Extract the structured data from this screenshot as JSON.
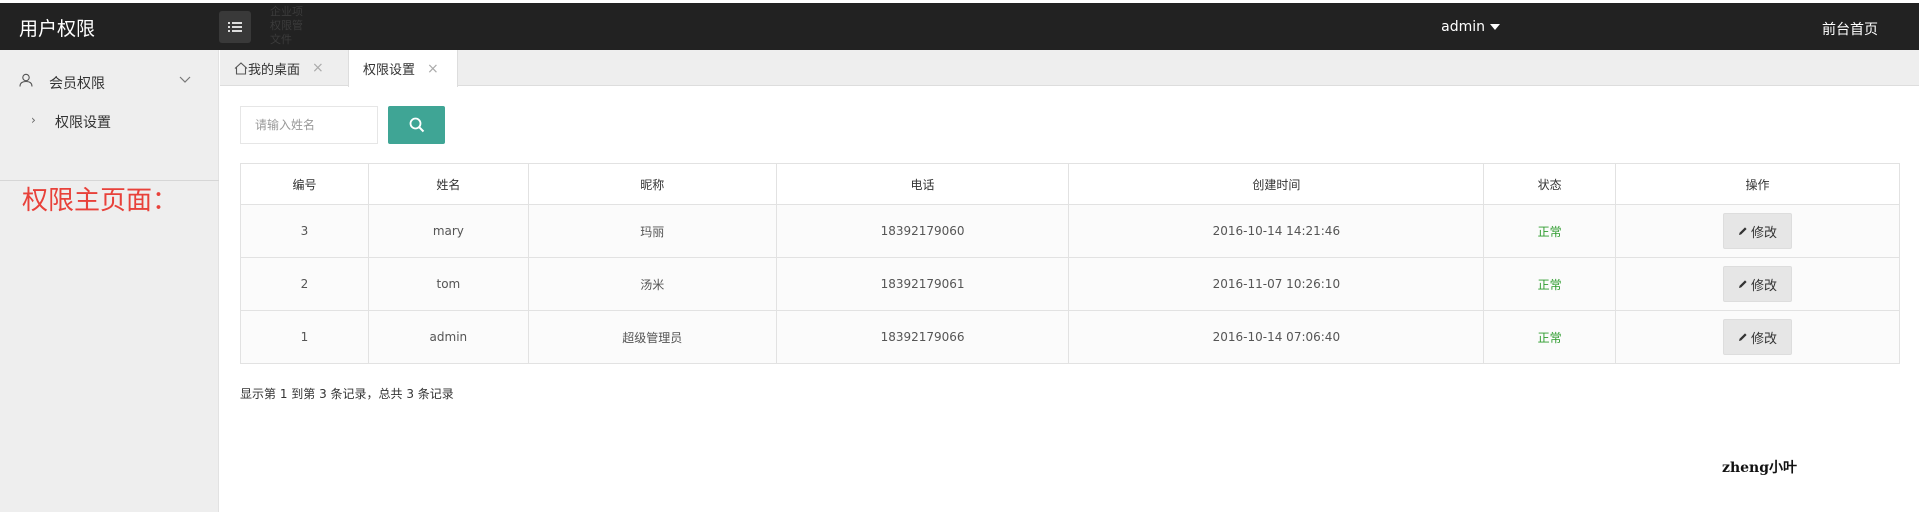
{
  "app": {
    "title": "用户权限"
  },
  "header": {
    "ghost_lines": [
      "企业项",
      "权限管",
      "文件"
    ],
    "user": "admin",
    "front_link": "前台首页"
  },
  "sidebar": {
    "group": {
      "label": "会员权限",
      "icon": "user-icon"
    },
    "items": [
      {
        "label": "权限设置"
      }
    ]
  },
  "annotation": {
    "note": "权限主页面："
  },
  "tabs": [
    {
      "label": "我的桌面",
      "icon": "home-icon",
      "active": false
    },
    {
      "label": "权限设置",
      "active": true
    }
  ],
  "search": {
    "placeholder": "请输入姓名",
    "value": ""
  },
  "table": {
    "columns": [
      "编号",
      "姓名",
      "昵称",
      "电话",
      "创建时间",
      "状态",
      "操作"
    ],
    "rows": [
      {
        "id": "3",
        "name": "mary",
        "nickname": "玛丽",
        "phone": "18392179060",
        "created": "2016-10-14 14:21:46",
        "status": "正常",
        "action": "修改"
      },
      {
        "id": "2",
        "name": "tom",
        "nickname": "汤米",
        "phone": "18392179061",
        "created": "2016-11-07 10:26:10",
        "status": "正常",
        "action": "修改"
      },
      {
        "id": "1",
        "name": "admin",
        "nickname": "超级管理员",
        "phone": "18392179066",
        "created": "2016-10-14 07:06:40",
        "status": "正常",
        "action": "修改"
      }
    ]
  },
  "pagination": {
    "info": "显示第 1 到第 3 条记录，总共 3 条记录"
  },
  "watermark": "zheng小叶",
  "colors": {
    "topbar": "#222222",
    "accent": "#3fa595",
    "status_ok": "#2e9c2e",
    "note": "#e8413a"
  }
}
